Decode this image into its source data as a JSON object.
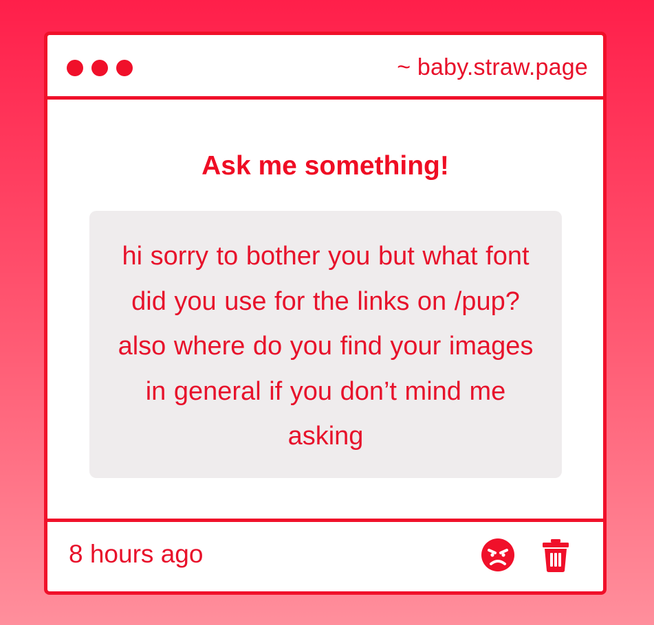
{
  "window": {
    "url": "~ baby.straw.page",
    "controls": [
      "dot-1",
      "dot-2",
      "dot-3"
    ]
  },
  "prompt": {
    "heading": "Ask me something!"
  },
  "question": {
    "text": "hi sorry to bother you but what font did you use for the links on /pup? also where do you find your images in general if you don’t mind me asking"
  },
  "footer": {
    "timestamp": "8 hours ago",
    "actions": [
      "angry-face-icon",
      "trash-icon"
    ]
  },
  "colors": {
    "accent": "#f0102a",
    "background_top": "#ff1f4a",
    "background_bottom": "#ff8f9c",
    "panel": "#ffffff",
    "question_box": "#efeced"
  }
}
